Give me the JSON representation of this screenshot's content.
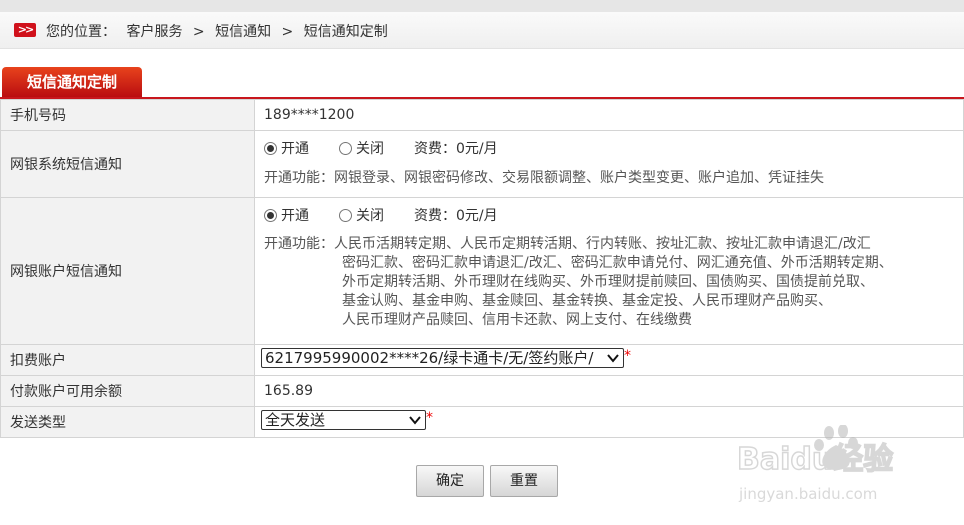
{
  "breadcrumb": {
    "icon": "double-chevron-right-icon",
    "prefix": "您的位置：",
    "items": [
      "客户服务",
      "短信通知",
      "短信通知定制"
    ],
    "separator": ">"
  },
  "tab": {
    "label": "短信通知定制"
  },
  "form": {
    "phone": {
      "label": "手机号码",
      "value": "189****1200"
    },
    "netbank_system": {
      "label": "网银系统短信通知",
      "opt_on": "开通",
      "opt_off": "关闭",
      "selected": "开通",
      "fee": "资费：0元/月",
      "features_label": "开通功能：",
      "features": "网银登录、网银密码修改、交易限额调整、账户类型变更、账户追加、凭证挂失"
    },
    "netbank_account": {
      "label": "网银账户短信通知",
      "opt_on": "开通",
      "opt_off": "关闭",
      "selected": "开通",
      "fee": "资费：0元/月",
      "features_label": "开通功能：",
      "features_lines": [
        "人民币活期转定期、人民币定期转活期、行内转账、按址汇款、按址汇款申请退汇/改汇",
        "密码汇款、密码汇款申请退汇/改汇、密码汇款申请兑付、网汇通充值、外币活期转定期、",
        "外币定期转活期、外币理财在线购买、外币理财提前赎回、国债购买、国债提前兑取、",
        "基金认购、基金申购、基金赎回、基金转换、基金定投、人民币理财产品购买、",
        "人民币理财产品赎回、信用卡还款、网上支付、在线缴费"
      ]
    },
    "debit_account": {
      "label": "扣费账户",
      "selected": "6217995990002****26/绿卡通卡/无/签约账户/",
      "required_mark": "*"
    },
    "balance": {
      "label": "付款账户可用余额",
      "value": "165.89"
    },
    "send_type": {
      "label": "发送类型",
      "selected": "全天发送",
      "required_mark": "*"
    }
  },
  "buttons": {
    "confirm": "确定",
    "reset": "重置"
  },
  "watermark": {
    "text": "Baidu经验",
    "subtext": "jingyan.baidu.com"
  },
  "colors": {
    "accent": "#c8161d",
    "label_bg": "#f2f2f2"
  }
}
